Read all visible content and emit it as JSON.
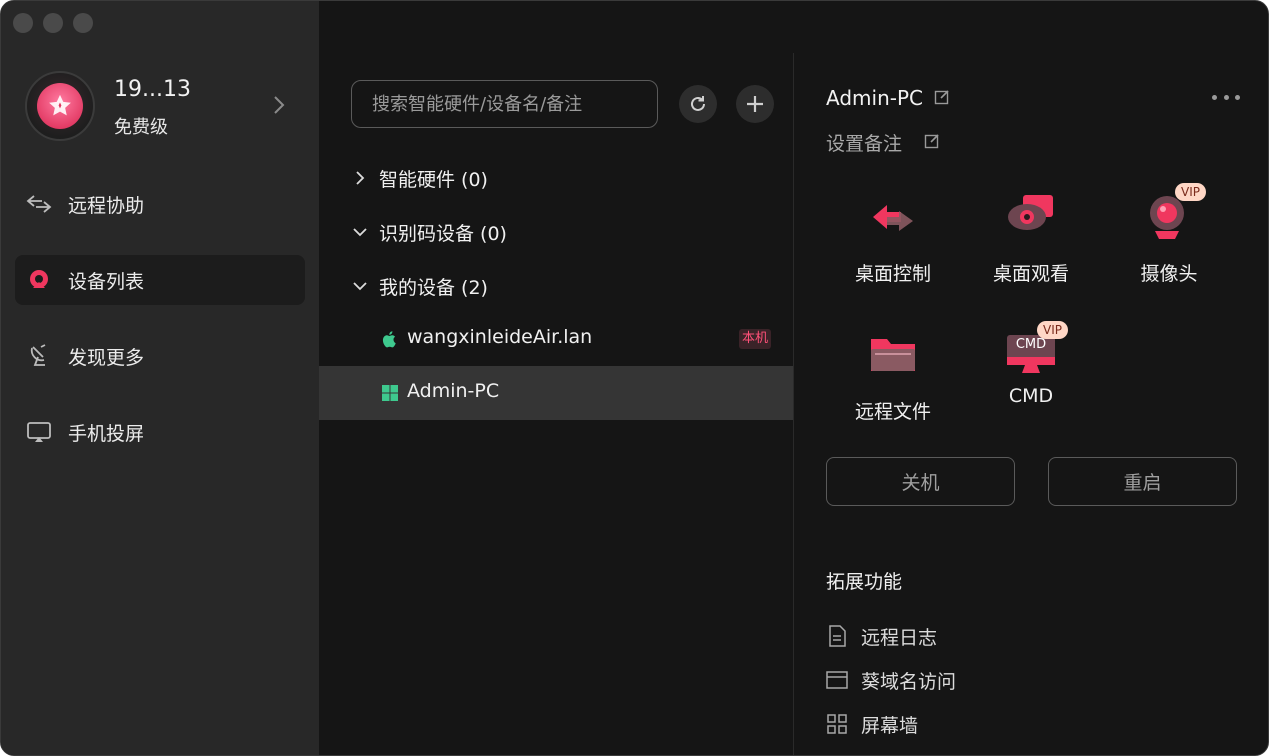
{
  "profile": {
    "name": "19...13",
    "tier": "免费级"
  },
  "nav": [
    {
      "label": "远程协助",
      "icon": "swap-arrows-icon"
    },
    {
      "label": "设备列表",
      "icon": "device-list-icon",
      "active": true
    },
    {
      "label": "发现更多",
      "icon": "satellite-dish-icon"
    },
    {
      "label": "手机投屏",
      "icon": "screen-cast-icon"
    }
  ],
  "search": {
    "placeholder": "搜索智能硬件/设备名/备注"
  },
  "groups": [
    {
      "label": "智能硬件 (0)",
      "expanded": false
    },
    {
      "label": "识别码设备 (0)",
      "expanded": true
    },
    {
      "label": "我的设备 (2)",
      "expanded": true
    }
  ],
  "devices": [
    {
      "name": "wangxinleideAir.lan",
      "os": "apple-icon",
      "badge": "本机"
    },
    {
      "name": "Admin-PC",
      "os": "windows-icon",
      "selected": true
    }
  ],
  "detail": {
    "title": "Admin-PC",
    "note": "设置备注",
    "features": [
      {
        "label": "桌面控制",
        "icon": "desktop-control-icon"
      },
      {
        "label": "桌面观看",
        "icon": "desktop-view-icon"
      },
      {
        "label": "摄像头",
        "icon": "camera-icon",
        "vip": "VIP"
      },
      {
        "label": "远程文件",
        "icon": "folder-icon"
      },
      {
        "label": "CMD",
        "icon": "cmd-icon",
        "vip": "VIP",
        "icon_text": "CMD"
      }
    ],
    "shutdown": "关机",
    "restart": "重启",
    "ext_title": "拓展功能",
    "ext_items": [
      {
        "label": "远程日志",
        "icon": "document-icon"
      },
      {
        "label": "葵域名访问",
        "icon": "browser-window-icon"
      },
      {
        "label": "屏幕墙",
        "icon": "grid-icon"
      }
    ]
  },
  "colors": {
    "accent": "#f0375f",
    "windows": "#3ec98e",
    "apple": "#3ec98e"
  }
}
